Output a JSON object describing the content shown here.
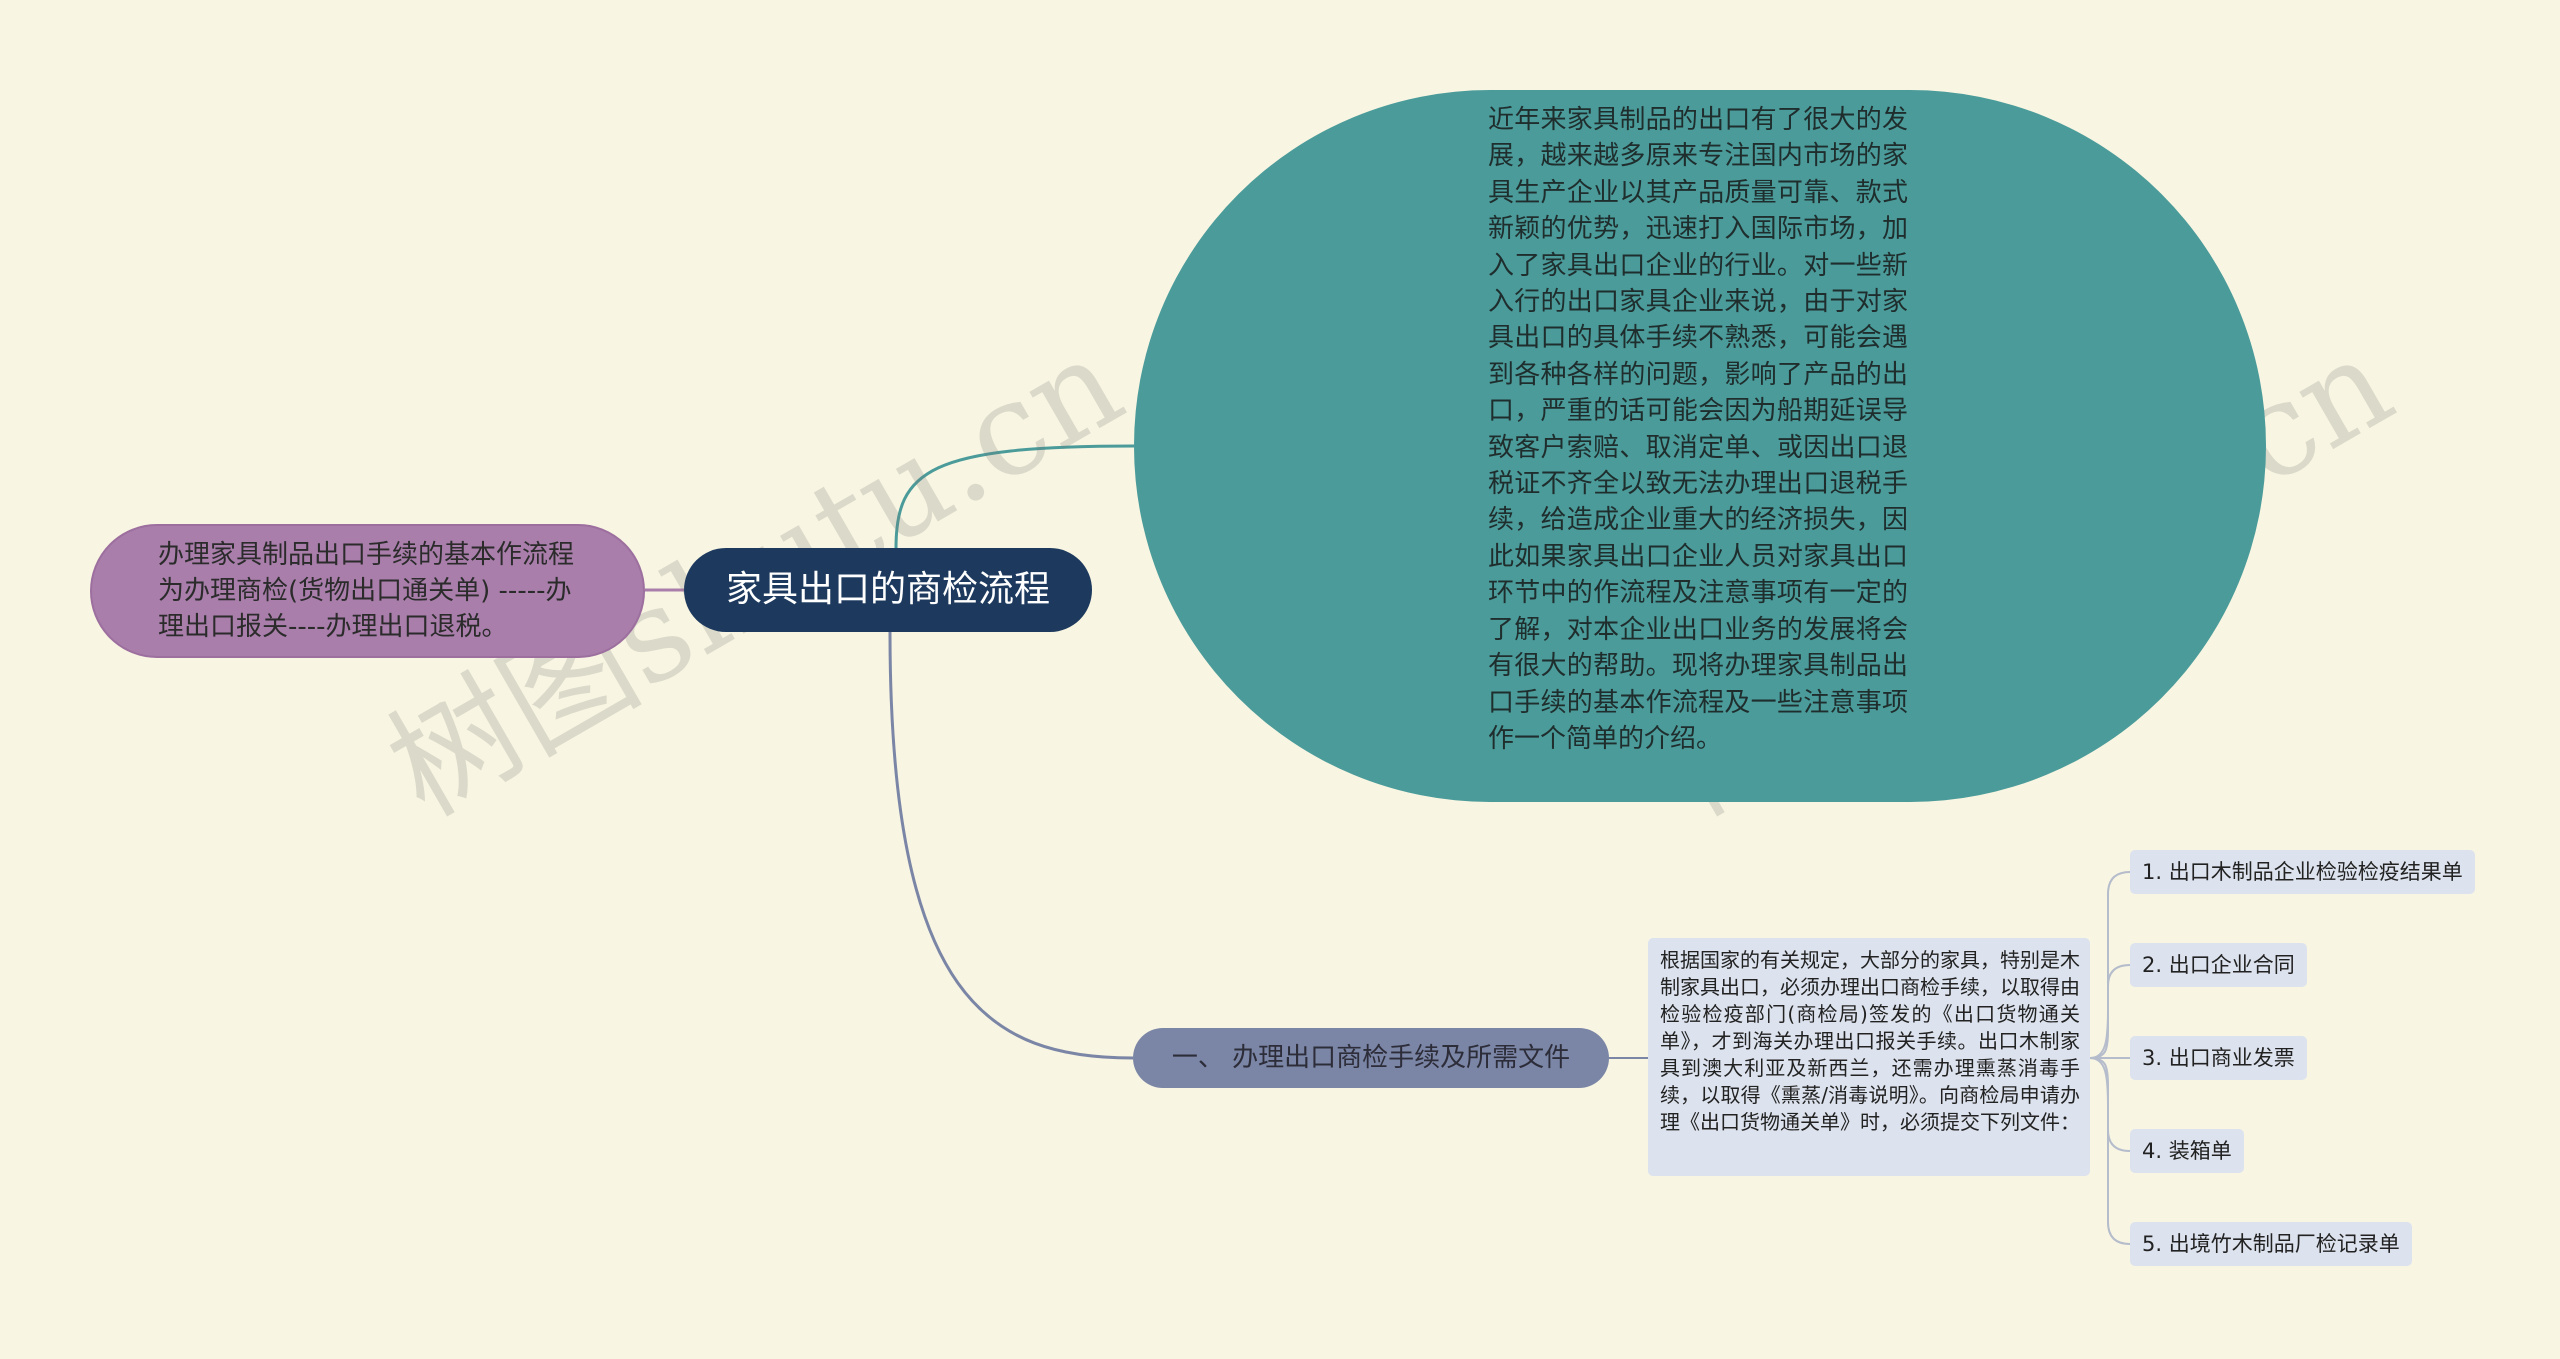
{
  "mindmap": {
    "root": {
      "label": "家具出口的商检流程"
    },
    "left_branch": {
      "label": "办理家具制品出口手续的基本作流程为办理商检(货物出口通关单) -----办理出口报关----办理出口退税。"
    },
    "intro_branch": {
      "label": "近年来家具制品的出口有了很大的发展，越来越多原来专注国内市场的家具生产企业以其产品质量可靠、款式新颖的优势，迅速打入国际市场，加入了家具出口企业的行业。对一些新入行的出口家具企业来说，由于对家具出口的具体手续不熟悉，可能会遇到各种各样的问题，影响了产品的出口，严重的话可能会因为船期延误导致客户索赔、取消定单、或因出口退税证不齐全以致无法办理出口退税手续，给造成企业重大的经济损失，因此如果家具出口企业人员对家具出口环节中的作流程及注意事项有一定的了解，对本企业出口业务的发展将会有很大的帮助。现将办理家具制品出口手续的基本作流程及一些注意事项作一个简单的介绍。"
    },
    "section_branch": {
      "label": "一、 办理出口商检手续及所需文件",
      "detail": "根据国家的有关规定，大部分的家具，特别是木制家具出口，必须办理出口商检手续，以取得由检验检疫部门(商检局)签发的《出口货物通关单》，才到海关办理出口报关手续。出口木制家具到澳大利亚及新西兰，还需办理熏蒸消毒手续，以取得《熏蒸/消毒说明》。向商检局申请办理《出口货物通关单》时，必须提交下列文件：",
      "documents": [
        "1. 出口木制品企业检验检疫结果单",
        "2. 出口企业合同",
        "3. 出口商业发票",
        "4. 装箱单",
        "5. 出境竹木制品厂检记录单"
      ]
    }
  },
  "watermark": {
    "text": "树图shutu.cn"
  },
  "colors": {
    "background": "#f8f5e2",
    "root": "#1d3a5e",
    "left_branch": "#a97eab",
    "intro_branch": "#4a9b9a",
    "section_branch": "#7b86a6",
    "leaf": "#dde3ee"
  }
}
